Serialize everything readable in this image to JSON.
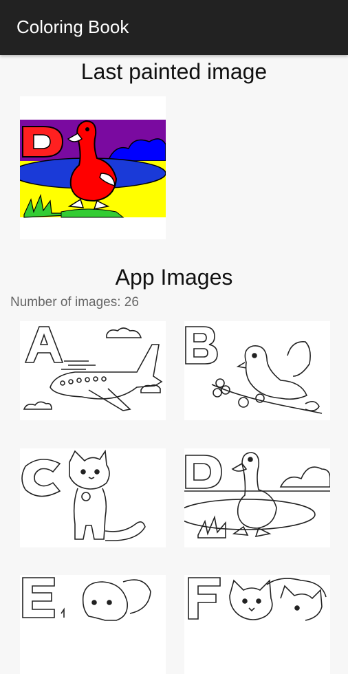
{
  "app": {
    "title": "Coloring Book"
  },
  "last_painted": {
    "heading": "Last painted image",
    "image": {
      "letter": "D",
      "subject": "duck",
      "colored": true
    }
  },
  "app_images": {
    "heading": "App Images",
    "count_text": "Number of images: 26",
    "items": [
      {
        "letter": "A",
        "subject": "airplane"
      },
      {
        "letter": "B",
        "subject": "bird"
      },
      {
        "letter": "C",
        "subject": "cat"
      },
      {
        "letter": "D",
        "subject": "duck"
      },
      {
        "letter": "E",
        "subject": "elephant"
      },
      {
        "letter": "F",
        "subject": "fox"
      }
    ]
  },
  "colors": {
    "appbar": "#222222",
    "background": "#f7f7f7",
    "duck_red": "#ff0000",
    "sky_purple": "#7a0aa0",
    "water_blue": "#0000ff",
    "ground_yellow": "#ffff00",
    "grass_green": "#33cc33"
  }
}
